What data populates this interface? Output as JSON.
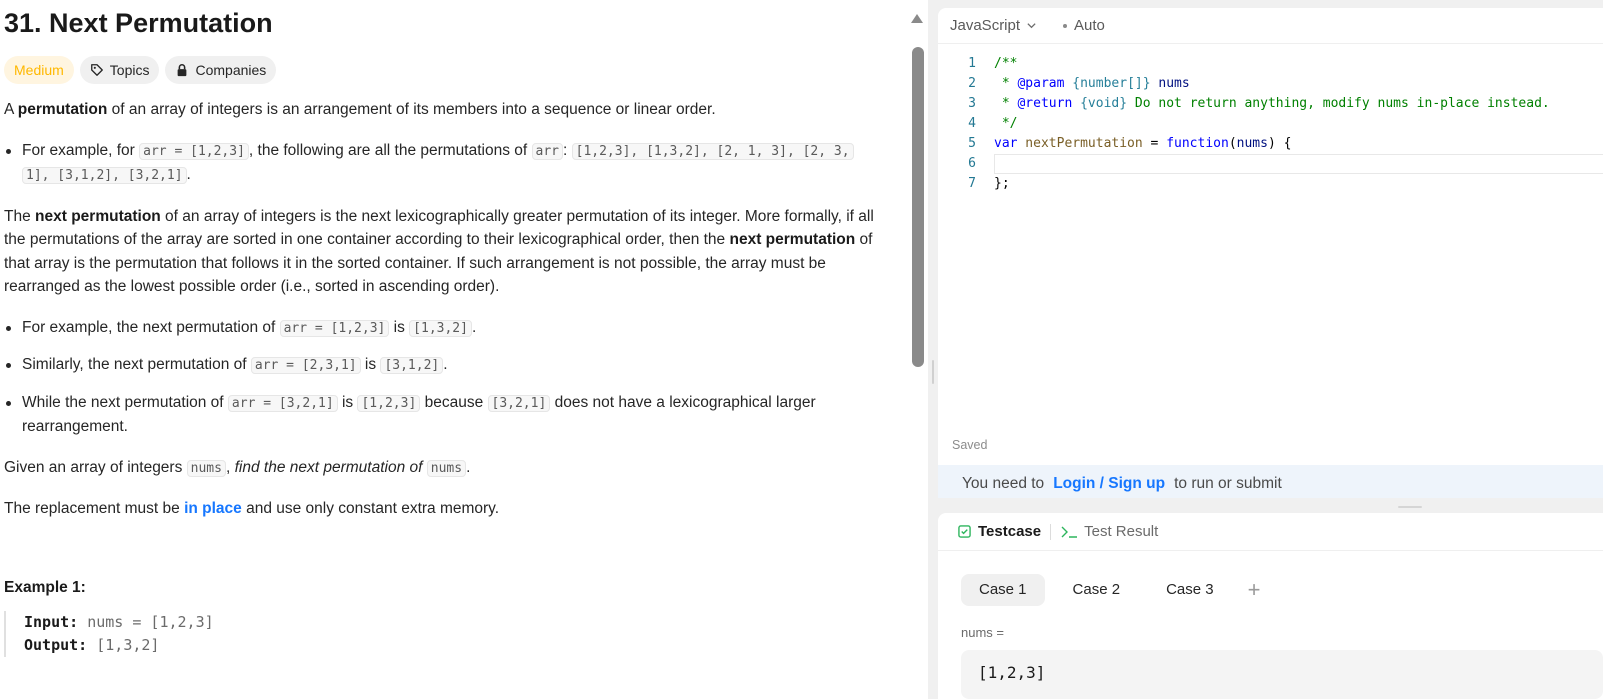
{
  "problem": {
    "title": "31. Next Permutation",
    "chips": {
      "difficulty": "Medium",
      "topics": "Topics",
      "companies": "Companies"
    },
    "intro": {
      "pre": "A ",
      "bold": "permutation",
      "post": " of an array of integers is an arrangement of its members into a sequence or linear order."
    },
    "bullet1": {
      "pre": "For example, for ",
      "code1": "arr = [1,2,3]",
      "mid": ", the following are all the permutations of ",
      "code2": "arr",
      "colon": ": ",
      "code3a": "[1,2,3], [1,3,2], [2, 1, 3], [2, 3,",
      "code3b": "1], [3,1,2], [3,2,1]",
      "end": "."
    },
    "next_para": {
      "p1": "The ",
      "b1": "next permutation",
      "p2": " of an array of integers is the next lexicographically greater permutation of its integer. More formally, if all the permutations of the array are sorted in one container according to their lexicographical order, then the ",
      "b2": "next permutation",
      "p3": " of that array is the permutation that follows it in the sorted container. If such arrangement is not possible, the array must be rearranged as the lowest possible order (i.e., sorted in ascending order)."
    },
    "ex_bullets": [
      {
        "pre": "For example, the next permutation of ",
        "c1": "arr = [1,2,3]",
        "mid": " is ",
        "c2": "[1,3,2]",
        "end": "."
      },
      {
        "pre": "Similarly, the next permutation of ",
        "c1": "arr = [2,3,1]",
        "mid": " is ",
        "c2": "[3,1,2]",
        "end": "."
      },
      {
        "pre": "While the next permutation of ",
        "c1": "arr = [3,2,1]",
        "mid": " is ",
        "c2": "[1,2,3]",
        "mid2": " because ",
        "c3": "[3,2,1]",
        "end": " does not have a lexicographical larger rearrangement."
      }
    ],
    "given": {
      "pre": "Given an array of integers ",
      "c1": "nums",
      "mid": ", ",
      "italic": "find the next permutation of",
      "sp": " ",
      "c2": "nums",
      "end": "."
    },
    "replace": {
      "pre": "The replacement must be ",
      "link": "in place",
      "post": " and use only constant extra memory."
    },
    "example1": {
      "title": "Example 1:",
      "input_label": "Input:",
      "input_val": " nums = [1,2,3]",
      "output_label": "Output:",
      "output_val": " [1,3,2]"
    }
  },
  "editor": {
    "language": "JavaScript",
    "mode": "Auto",
    "lines": [
      {
        "n": "1"
      },
      {
        "n": "2"
      },
      {
        "n": "3"
      },
      {
        "n": "4"
      },
      {
        "n": "5"
      },
      {
        "n": "6"
      },
      {
        "n": "7"
      }
    ],
    "code": {
      "l1": "/**",
      "l2a": " * ",
      "l2tag": "@param",
      "l2type": " {number[]}",
      "l2var": " nums",
      "l3a": " * ",
      "l3tag": "@return",
      "l3type": " {void}",
      "l3rest": " Do not return anything, modify nums in-place instead.",
      "l4": " */",
      "l5kw": "var",
      "l5fn": " nextPermutation",
      "l5eq": " = ",
      "l5kw2": "function",
      "l5p1": "(",
      "l5var": "nums",
      "l5p2": ") {",
      "l6": "",
      "l7": "};"
    },
    "saved": "Saved",
    "login": {
      "pre": "You need to",
      "link": "Login / Sign up",
      "post": "to run or submit"
    }
  },
  "testcase": {
    "tab_testcase": "Testcase",
    "tab_result": "Test Result",
    "cases": [
      "Case 1",
      "Case 2",
      "Case 3"
    ],
    "add": "+",
    "param_label": "nums =",
    "param_value": "[1,2,3]"
  },
  "colors": {
    "accent": "#1677ff",
    "medium": "#ffb800",
    "success": "#2db55d"
  }
}
